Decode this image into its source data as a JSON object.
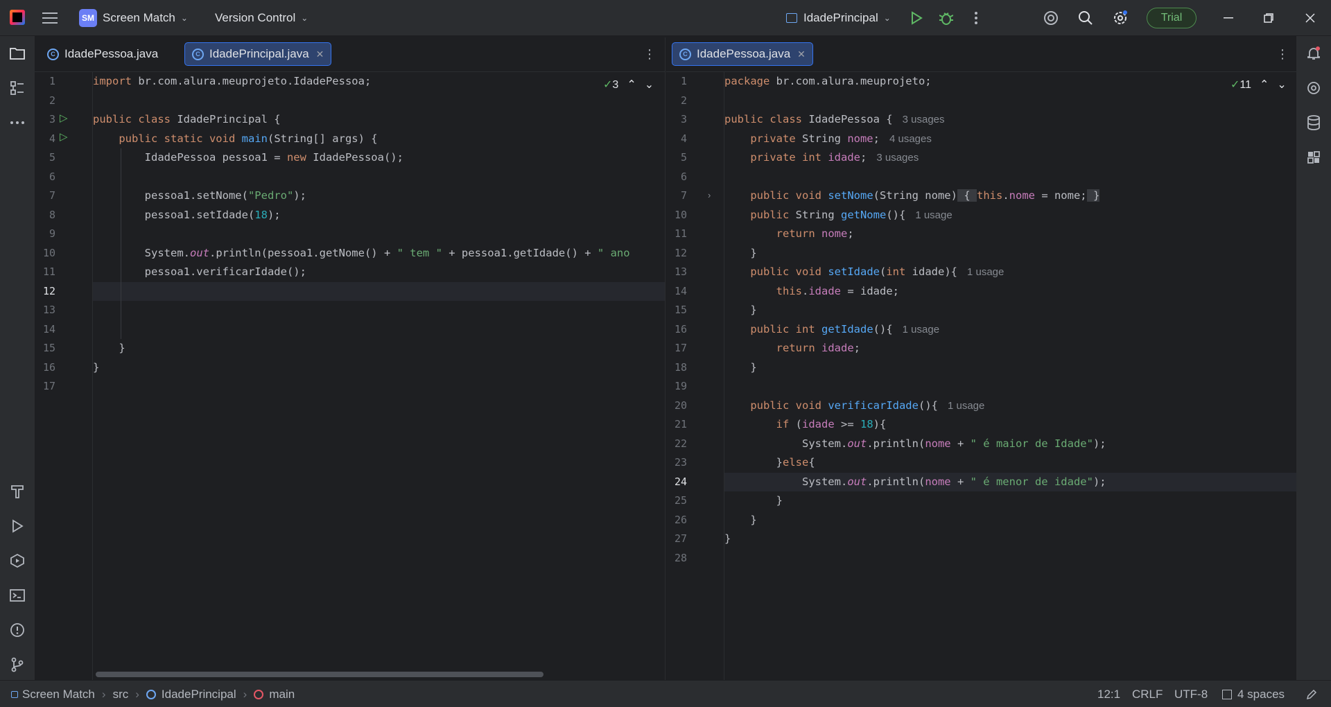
{
  "titlebar": {
    "project": "Screen Match",
    "project_badge": "SM",
    "vcs": "Version Control",
    "run_config": "IdadePrincipal",
    "trial": "Trial"
  },
  "left_editor": {
    "tabs": [
      {
        "label": "IdadePessoa.java",
        "active": false
      },
      {
        "label": "IdadePrincipal.java",
        "active": true
      }
    ],
    "inspection_count": "3",
    "current_line": 12
  },
  "right_editor": {
    "tabs": [
      {
        "label": "IdadePessoa.java",
        "active": true
      }
    ],
    "inspection_count": "11",
    "current_line": 24
  },
  "statusbar": {
    "crumbs": [
      "Screen Match",
      "src",
      "IdadePrincipal",
      "main"
    ],
    "position": "12:1",
    "line_sep": "CRLF",
    "encoding": "UTF-8",
    "indent": "4 spaces"
  },
  "colors": {
    "keyword": "#cf8e6d",
    "string": "#6aab73",
    "number": "#2aacb8",
    "function": "#56a8f5",
    "field": "#c77dbb",
    "accent": "#3574f0"
  }
}
